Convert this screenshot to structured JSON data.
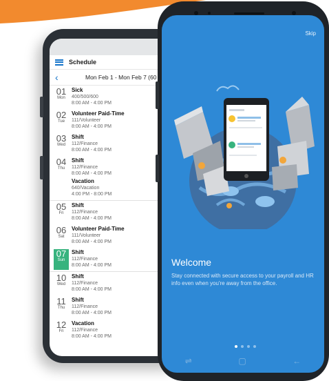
{
  "schedule_app": {
    "title": "Schedule",
    "date_range": "Mon Feb 1 - Mon Feb 7 (60",
    "days": [
      {
        "num": "01",
        "weekday": "Mon",
        "entries": [
          {
            "title": "Sick",
            "line1": "400/500/600",
            "line2": "8:00 AM - 4:00 PM"
          }
        ]
      },
      {
        "num": "02",
        "weekday": "Tue",
        "entries": [
          {
            "title": "Volunteer Paid-Time",
            "line1": "111/Volunteer",
            "line2": "8:00 AM - 4:00 PM"
          }
        ]
      },
      {
        "num": "03",
        "weekday": "Wed",
        "entries": [
          {
            "title": "Shift",
            "line1": "112/Finance",
            "line2": "8:00 AM - 4:00 PM"
          }
        ]
      },
      {
        "num": "04",
        "weekday": "Thu",
        "entries": [
          {
            "title": "Shift",
            "line1": "112/Finance",
            "line2": "8:00 AM - 4:00 PM"
          },
          {
            "title": "Vacation",
            "line1": "640/Vacation",
            "line2": "4:00 PM - 8:00 PM"
          }
        ]
      },
      {
        "num": "05",
        "weekday": "Fri",
        "entries": [
          {
            "title": "Shift",
            "line1": "112/Finance",
            "line2": "8:00 AM - 4:00 PM"
          }
        ]
      },
      {
        "num": "06",
        "weekday": "Sat",
        "entries": [
          {
            "title": "Volunteer Paid-Time",
            "line1": "111/Volunteer",
            "line2": "8:00 AM - 4:00 PM"
          }
        ]
      },
      {
        "num": "07",
        "weekday": "Sun",
        "entries": [
          {
            "title": "Shift",
            "line1": "112/Finance",
            "line2": "8:00 AM - 4:00 PM"
          }
        ]
      },
      {
        "num": "10",
        "weekday": "Wed",
        "entries": [
          {
            "title": "Shift",
            "line1": "112/Finance",
            "line2": "8:00 AM - 4:00 PM"
          }
        ]
      },
      {
        "num": "11",
        "weekday": "Thu",
        "entries": [
          {
            "title": "Shift",
            "line1": "112/Finance",
            "line2": "8:00 AM - 4:00 PM"
          }
        ]
      },
      {
        "num": "12",
        "weekday": "Fri",
        "entries": [
          {
            "title": "Vacation",
            "line1": "112/Finance",
            "line2": "8:00 AM - 4:00 PM"
          }
        ]
      }
    ],
    "selected_day": "07",
    "accent": "#1473c9",
    "selected_color": "#37b37e"
  },
  "onboarding": {
    "skip": "Skip",
    "heading": "Welcome",
    "description": "Stay connected with secure access to your payroll and HR info even when you're away from the office.",
    "page_count": 4,
    "current_page": 1,
    "background": "#2e89d6"
  },
  "icons": {
    "menu": "hamburger-icon",
    "back": "chevron-left-icon",
    "nav_recent": "recent-apps-icon",
    "nav_home": "home-icon",
    "nav_back": "back-arrow-icon"
  }
}
